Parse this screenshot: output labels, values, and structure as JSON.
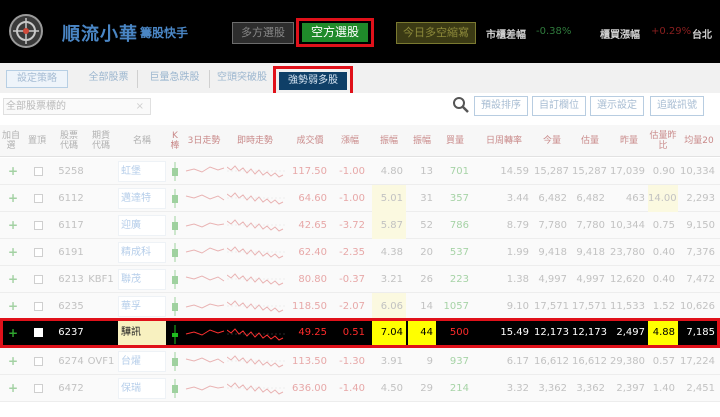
{
  "header": {
    "brand": "順流小華",
    "brand_sub": "籌股快手",
    "buttons": {
      "multi": "多方選股",
      "short": "空方選股",
      "today": "今日多空縮寫"
    },
    "stats": [
      {
        "label": "市櫃差幅",
        "value": "-0.38%"
      },
      {
        "label": "櫃買漲幅",
        "value": "+0.29%",
        "suffix": "台北"
      }
    ]
  },
  "tabs": [
    "設定策略",
    "全部股票",
    "巨量急跌股",
    "空頭突破股",
    "強勢弱多股"
  ],
  "filter": {
    "select_value": "全部股票標的",
    "buttons": [
      "預設排序",
      "自訂欄位",
      "選示設定",
      "追蹤訊號"
    ]
  },
  "columns": [
    "加自選",
    "置頂",
    "股票代碼",
    "期貨代碼",
    "名稱",
    "K棒",
    "3日走勢",
    "即時走勢",
    "成交價",
    "漲幅",
    "振幅",
    "振幅",
    "買量",
    "日周轉率",
    "今量",
    "估量",
    "昨量",
    "估量昨比",
    "均量20"
  ],
  "rows": [
    {
      "code": "5258",
      "fut": "",
      "name": "虹堡",
      "price": "117.50",
      "change": "-1.00",
      "amp": "4.80",
      "amp2": "13",
      "vol": "701",
      "turnover": "14.59",
      "today": "15,287",
      "est": "15,287",
      "yest": "17,039",
      "ratio": "0.90",
      "avg20": "10,334"
    },
    {
      "code": "6112",
      "fut": "",
      "name": "邁達特",
      "price": "64.60",
      "change": "-1.00",
      "amp": "5.01",
      "amp2": "31",
      "vol": "357",
      "turnover": "3.44",
      "today": "6,482",
      "est": "6,482",
      "yest": "463",
      "ratio": "14.00",
      "avg20": "2,293"
    },
    {
      "code": "6117",
      "fut": "",
      "name": "迎廣",
      "price": "42.65",
      "change": "-3.72",
      "amp": "5.87",
      "amp2": "52",
      "vol": "786",
      "turnover": "8.79",
      "today": "7,780",
      "est": "7,780",
      "yest": "10,344",
      "ratio": "0.75",
      "avg20": "9,150"
    },
    {
      "code": "6191",
      "fut": "",
      "name": "精成科",
      "price": "62.40",
      "change": "-2.35",
      "amp": "4.38",
      "amp2": "20",
      "vol": "537",
      "turnover": "1.99",
      "today": "9,418",
      "est": "9,418",
      "yest": "23,780",
      "ratio": "0.40",
      "avg20": "7,376"
    },
    {
      "code": "6213",
      "fut": "KBF1",
      "name": "聯茂",
      "price": "80.80",
      "change": "-0.37",
      "amp": "3.21",
      "amp2": "26",
      "vol": "223",
      "turnover": "1.38",
      "today": "4,997",
      "est": "4,997",
      "yest": "12,620",
      "ratio": "0.40",
      "avg20": "7,472"
    },
    {
      "code": "6235",
      "fut": "",
      "name": "華孚",
      "price": "118.50",
      "change": "-2.07",
      "amp": "6.06",
      "amp2": "14",
      "vol": "1057",
      "turnover": "9.10",
      "today": "17,571",
      "est": "17,571",
      "yest": "11,533",
      "ratio": "1.52",
      "avg20": "10,626"
    },
    {
      "code": "6237",
      "fut": "",
      "name": "驊訊",
      "price": "49.25",
      "change": "0.51",
      "amp": "7.04",
      "amp2": "44",
      "vol": "500",
      "turnover": "15.49",
      "today": "12,173",
      "est": "12,173",
      "yest": "2,497",
      "ratio": "4.88",
      "avg20": "7,185"
    },
    {
      "code": "6274",
      "fut": "OVF1",
      "name": "台燿",
      "price": "113.50",
      "change": "-1.30",
      "amp": "3.91",
      "amp2": "9",
      "vol": "937",
      "turnover": "6.17",
      "today": "16,612",
      "est": "16,612",
      "yest": "29,380",
      "ratio": "0.57",
      "avg20": "17,224"
    },
    {
      "code": "6472",
      "fut": "",
      "name": "保瑞",
      "price": "636.00",
      "change": "-1.40",
      "amp": "4.50",
      "amp2": "29",
      "vol": "214",
      "turnover": "3.32",
      "today": "3,362",
      "est": "3,362",
      "yest": "2,397",
      "ratio": "1.40",
      "avg20": "2,451"
    }
  ],
  "colors": {
    "highlight": "#e0111a",
    "short_button": "#1f8a2a",
    "strong_tab": "#0f3f67"
  }
}
